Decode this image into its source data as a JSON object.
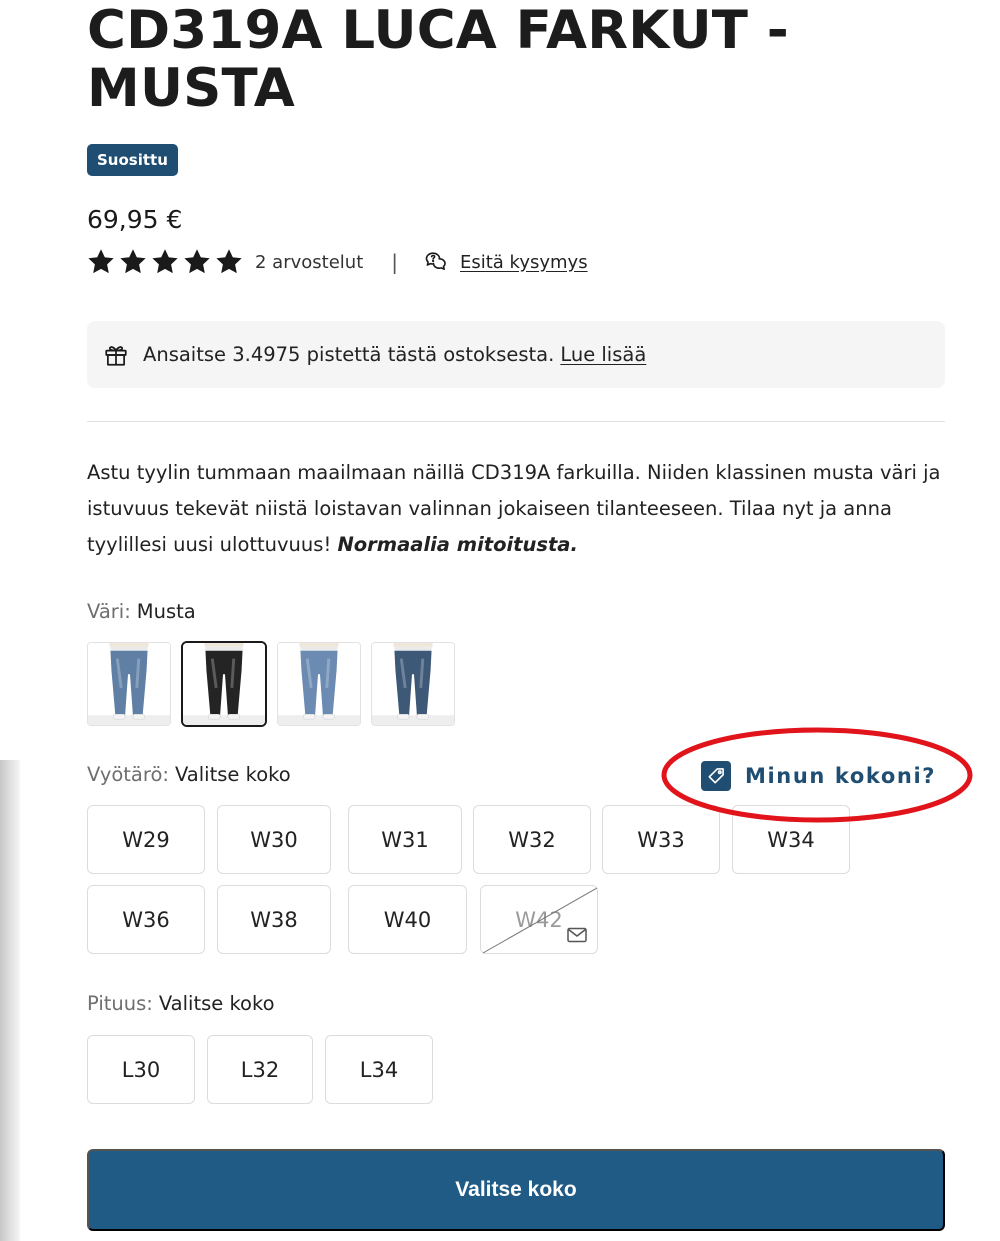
{
  "product": {
    "title": "CD319A LUCA FARKUT - MUSTA",
    "badge": "Suosittu",
    "price": "69,95 €",
    "rating": {
      "stars": 5,
      "max": 5,
      "reviews_label": "2 arvostelut"
    },
    "ask_question_label": "Esitä kysymys",
    "separator": "|"
  },
  "points": {
    "text": "Ansaitse 3.4975 pistettä tästä ostoksesta.",
    "link": "Lue lisää"
  },
  "description": {
    "text": "Astu tyylin tummaan maailmaan näillä CD319A farkuilla. Niiden klassinen musta väri ja istuvuus tekevät niistä loistavan valinnan jokaiseen tilanteeseen. Tilaa nyt ja anna tyylillesi uusi ulottuvuus!",
    "emphasis": "Normaalia mitoitusta."
  },
  "color": {
    "label": "Väri:",
    "value": "Musta",
    "swatches": [
      {
        "name": "blue-light",
        "selected": false,
        "color": "#5f7fa5"
      },
      {
        "name": "black",
        "selected": true,
        "color": "#242424"
      },
      {
        "name": "blue-washed",
        "selected": false,
        "color": "#6b8bb2"
      },
      {
        "name": "blue-dark",
        "selected": false,
        "color": "#3e5878"
      }
    ]
  },
  "waist": {
    "label": "Vyötärö:",
    "value": "Valitse koko",
    "my_size_link": "Minun kokoni?",
    "sizes": [
      {
        "label": "W29",
        "available": true
      },
      {
        "label": "W30",
        "available": true
      },
      {
        "label": "W31",
        "available": true
      },
      {
        "label": "W32",
        "available": true
      },
      {
        "label": "W33",
        "available": true
      },
      {
        "label": "W34",
        "available": true
      },
      {
        "label": "W36",
        "available": true
      },
      {
        "label": "W38",
        "available": true
      },
      {
        "label": "W40",
        "available": true
      },
      {
        "label": "W42",
        "available": false
      }
    ]
  },
  "length": {
    "label": "Pituus:",
    "value": "Valitse koko",
    "sizes": [
      {
        "label": "L30",
        "available": true
      },
      {
        "label": "L32",
        "available": true
      },
      {
        "label": "L34",
        "available": true
      }
    ]
  },
  "cta": {
    "label": "Valitse koko"
  },
  "colors": {
    "brand": "#1f4e72",
    "button": "#1f5b85",
    "highlight": "#e1141b"
  },
  "icons": {
    "star": "star-icon",
    "ask": "chat-question-icon",
    "gift": "gift-icon",
    "tag": "tag-icon",
    "notify": "mail-icon"
  }
}
